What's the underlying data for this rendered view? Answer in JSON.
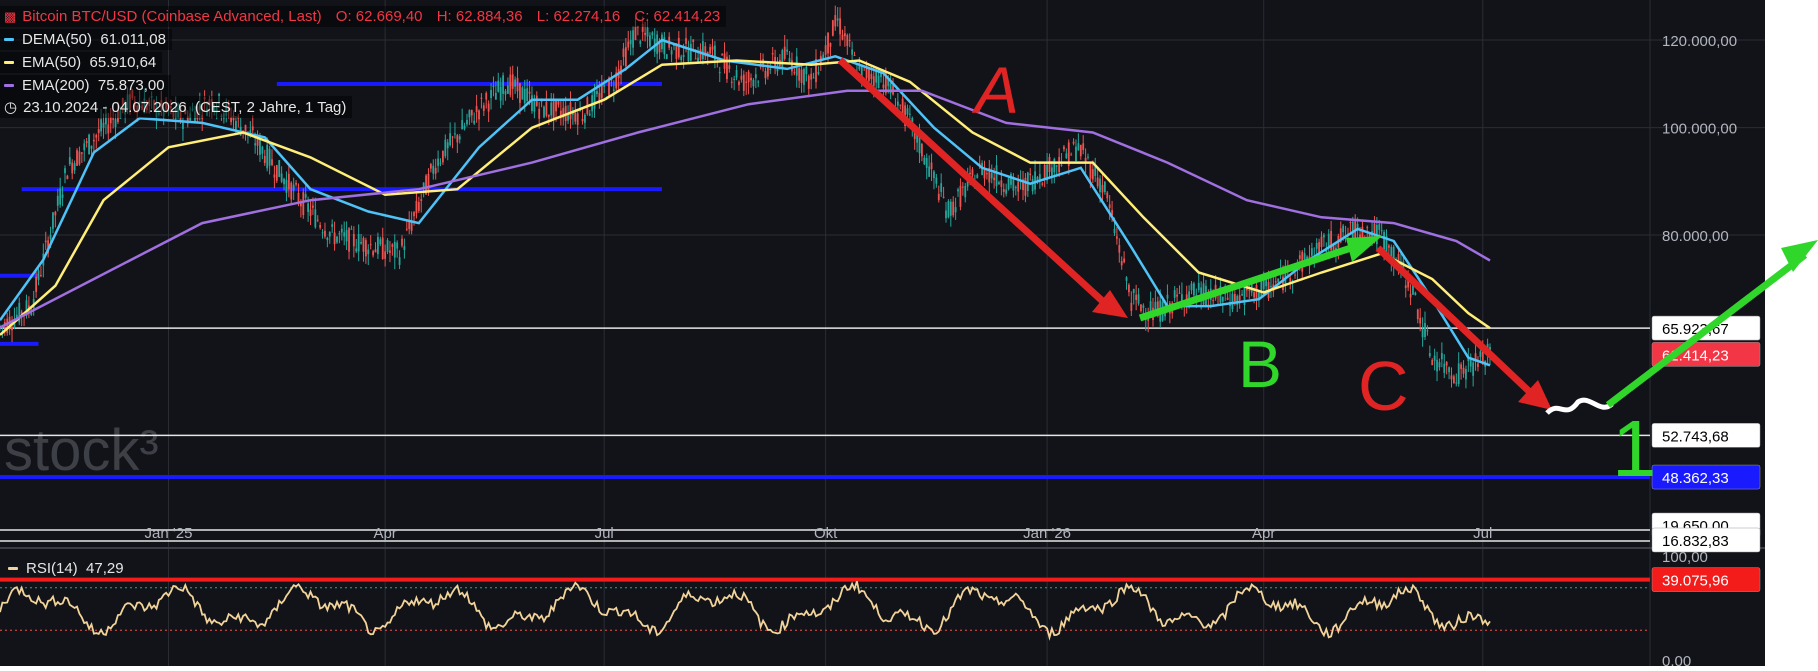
{
  "legend": {
    "symbol_title": "Bitcoin BTC/USD (Coinbase Advanced, Last)",
    "ohlc": [
      {
        "label": "O:",
        "value": "62.669,40"
      },
      {
        "label": "H:",
        "value": "62.884,36"
      },
      {
        "label": "L:",
        "value": "62.274,16"
      },
      {
        "label": "C:",
        "value": "62.414,23"
      }
    ],
    "indicators": [
      {
        "name": "DEMA(50)",
        "value": "61.011,08",
        "color": "#4fc3f7"
      },
      {
        "name": "EMA(50)",
        "value": "65.910,64",
        "color": "#ffee77"
      },
      {
        "name": "EMA(200)",
        "value": "75.873,00",
        "color": "#a070e0"
      }
    ],
    "date_range": "23.10.2024 - 04.07.2026",
    "range_info": "(CEST, 2 Jahre, 1 Tag)"
  },
  "watermark": "stock³",
  "price_labels": [
    {
      "text": "65.923,67",
      "bg": "#ffffff",
      "fg": "#000000",
      "price": 65923.67
    },
    {
      "text": "62.414,23",
      "bg": "#f23645",
      "fg": "#ffffff",
      "price": 62414.23
    },
    {
      "text": "52.743,68",
      "bg": "#ffffff",
      "fg": "#000000",
      "price": 52743.68
    },
    {
      "text": "48.362,33",
      "bg": "#1a1aff",
      "fg": "#ffffff",
      "price": 48362.33
    },
    {
      "text": "39.075,96",
      "bg": "#f41b1b",
      "fg": "#ffffff",
      "price": 39075.96
    },
    {
      "text": "19.650,00",
      "bg": "#ffffff",
      "fg": "#000000",
      "price": 19650.0
    },
    {
      "text": "16.832,83",
      "bg": "#ffffff",
      "fg": "#000000",
      "price": 16832.83
    }
  ],
  "annotations": {
    "wave_a": "A",
    "wave_b": "B",
    "wave_c": "C",
    "wave_1": "1"
  },
  "rsi": {
    "name": "RSI(14)",
    "value": "47,29",
    "axis_labels": [
      "100,00",
      "0,00"
    ],
    "upper_band": 70,
    "lower_band": 30
  },
  "chart_data": {
    "type": "line",
    "title": "Bitcoin BTC/USD (Coinbase Advanced, Last)",
    "y_axis_ticks": [
      "120.000,00",
      "100.000,00",
      "80.000,00"
    ],
    "y_tick_values": [
      120000,
      100000,
      80000
    ],
    "x_axis_ticks": [
      "Jan '25",
      "Apr",
      "Jul",
      "Okt",
      "Jan '26",
      "Apr",
      "Jul"
    ],
    "x_tick_dates": [
      "2025-01-01",
      "2025-04-01",
      "2025-07-01",
      "2025-10-01",
      "2026-01-01",
      "2026-04-01",
      "2026-07-01"
    ],
    "x_range": [
      "2024-10-23",
      "2026-07-04"
    ],
    "grid": true,
    "scale": "log",
    "series": [
      {
        "name": "Bitcoin BTC/USD",
        "color": "#26a69a",
        "x": [
          "2024-10-23",
          "2024-11-05",
          "2024-11-20",
          "2024-12-05",
          "2024-12-17",
          "2025-01-07",
          "2025-01-20",
          "2025-02-05",
          "2025-02-25",
          "2025-03-10",
          "2025-04-07",
          "2025-04-22",
          "2025-05-10",
          "2025-05-22",
          "2025-06-05",
          "2025-06-22",
          "2025-07-05",
          "2025-07-14",
          "2025-07-28",
          "2025-08-14",
          "2025-08-28",
          "2025-09-15",
          "2025-09-25",
          "2025-10-06",
          "2025-10-15",
          "2025-10-25",
          "2025-11-05",
          "2025-11-21",
          "2025-12-05",
          "2025-12-20",
          "2026-01-05",
          "2026-01-14",
          "2026-01-25",
          "2026-02-05",
          "2026-02-15",
          "2026-03-01",
          "2026-03-20",
          "2026-04-05",
          "2026-04-25",
          "2026-05-10",
          "2026-05-20",
          "2026-06-01",
          "2026-06-10",
          "2026-06-20",
          "2026-07-04"
        ],
        "values": [
          66000,
          69000,
          92000,
          100000,
          106000,
          102000,
          106000,
          98000,
          86000,
          80000,
          77000,
          93000,
          104000,
          110000,
          104000,
          103000,
          110000,
          122000,
          118000,
          117000,
          110000,
          116000,
          110000,
          125000,
          112000,
          111000,
          101000,
          84000,
          92000,
          88000,
          93000,
          96000,
          88000,
          70000,
          68000,
          71000,
          70000,
          72000,
          78000,
          81000,
          80000,
          72000,
          62000,
          60000,
          62414
        ]
      },
      {
        "name": "DEMA(50)",
        "color": "#4fc3f7",
        "x": [
          "2024-10-23",
          "2024-11-10",
          "2024-12-01",
          "2024-12-20",
          "2025-01-15",
          "2025-02-10",
          "2025-03-01",
          "2025-03-25",
          "2025-04-15",
          "2025-05-10",
          "2025-06-01",
          "2025-06-20",
          "2025-07-10",
          "2025-07-25",
          "2025-08-20",
          "2025-09-15",
          "2025-10-05",
          "2025-10-25",
          "2025-11-15",
          "2025-12-05",
          "2025-12-25",
          "2026-01-15",
          "2026-02-05",
          "2026-02-20",
          "2026-03-10",
          "2026-03-30",
          "2026-04-20",
          "2026-05-10",
          "2026-05-25",
          "2026-06-10",
          "2026-06-25",
          "2026-07-04"
        ],
        "values": [
          67000,
          76000,
          95000,
          102000,
          101000,
          98000,
          88000,
          84000,
          82000,
          96000,
          106000,
          106000,
          113000,
          120000,
          115000,
          113000,
          116000,
          112000,
          100000,
          92000,
          89000,
          92000,
          78000,
          69000,
          69000,
          70000,
          76000,
          81000,
          79000,
          70000,
          62000,
          61011
        ]
      },
      {
        "name": "EMA(50)",
        "color": "#ffee77",
        "x": [
          "2024-10-23",
          "2024-11-15",
          "2024-12-05",
          "2025-01-01",
          "2025-02-01",
          "2025-03-01",
          "2025-04-01",
          "2025-05-01",
          "2025-06-01",
          "2025-07-01",
          "2025-07-25",
          "2025-08-25",
          "2025-09-25",
          "2025-10-15",
          "2025-11-05",
          "2025-12-01",
          "2025-12-25",
          "2026-01-20",
          "2026-02-10",
          "2026-03-05",
          "2026-04-01",
          "2026-04-25",
          "2026-05-20",
          "2026-06-10",
          "2026-06-25",
          "2026-07-04"
        ],
        "values": [
          65000,
          72000,
          86000,
          96000,
          99000,
          94000,
          87000,
          88000,
          100000,
          106000,
          114000,
          115000,
          114000,
          115000,
          110000,
          99000,
          93000,
          93000,
          83000,
          74000,
          71000,
          74000,
          77000,
          73000,
          68000,
          65911
        ]
      },
      {
        "name": "EMA(200)",
        "color": "#a070e0",
        "x": [
          "2024-10-23",
          "2024-12-01",
          "2025-01-15",
          "2025-03-01",
          "2025-04-15",
          "2025-06-01",
          "2025-07-15",
          "2025-08-30",
          "2025-10-10",
          "2025-11-10",
          "2025-12-15",
          "2026-01-20",
          "2026-02-20",
          "2026-03-25",
          "2026-04-25",
          "2026-05-25",
          "2026-06-20",
          "2026-07-04"
        ],
        "values": [
          66000,
          73000,
          82000,
          86000,
          88000,
          93000,
          99000,
          105000,
          108000,
          108000,
          101000,
          99000,
          93000,
          86000,
          83000,
          82000,
          79000,
          75873
        ]
      }
    ]
  }
}
